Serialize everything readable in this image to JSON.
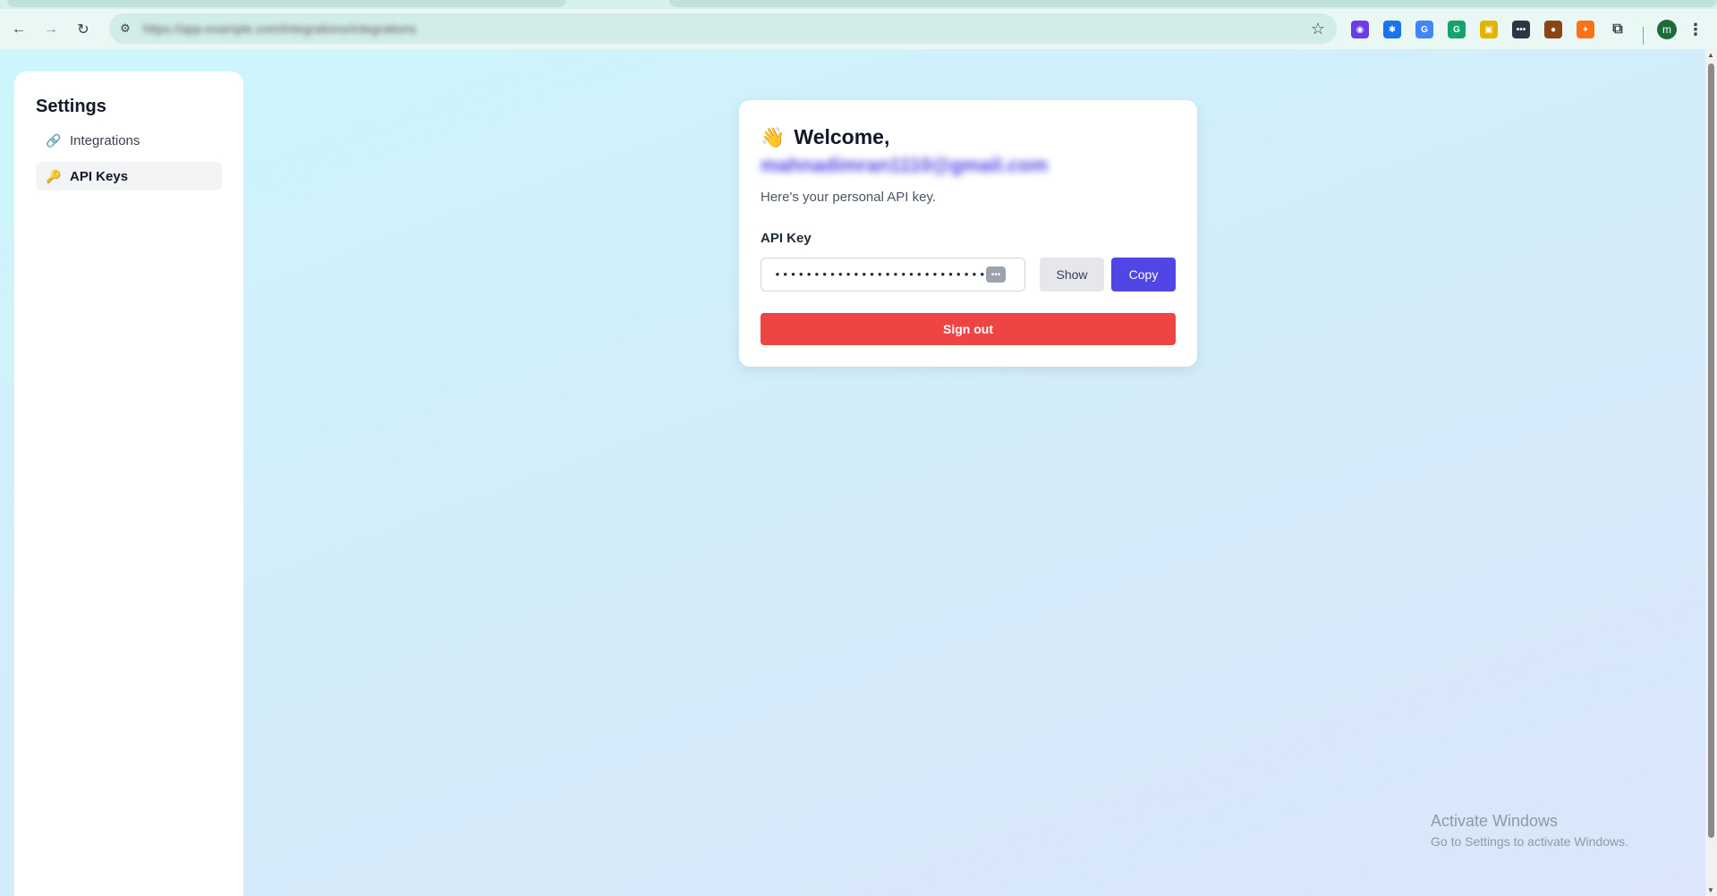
{
  "browser": {
    "url": "https://app.example.com/integrations/integrations",
    "profile_initial": "m",
    "extensions": [
      {
        "name": "color-picker-icon",
        "color": "#6a3de8",
        "glyph": "◉"
      },
      {
        "name": "extension-gear-icon",
        "color": "#1a73e8",
        "glyph": "✱"
      },
      {
        "name": "translate-icon",
        "color": "#4285f4",
        "glyph": "G"
      },
      {
        "name": "grammarly-icon",
        "color": "#15a26b",
        "glyph": "G"
      },
      {
        "name": "ad-extension-icon",
        "color": "#e2b400",
        "glyph": "▣"
      },
      {
        "name": "password-manager-icon",
        "color": "#2f3542",
        "glyph": "•••"
      },
      {
        "name": "cookie-icon",
        "color": "#8b4513",
        "glyph": "●"
      },
      {
        "name": "fire-extension-icon",
        "color": "#f97316",
        "glyph": "✦"
      },
      {
        "name": "extensions-puzzle-icon",
        "color": "#3c4043",
        "glyph": "⧉"
      }
    ]
  },
  "sidebar": {
    "title": "Settings",
    "items": [
      {
        "label": "Integrations",
        "icon": "link-icon",
        "active": false
      },
      {
        "label": "API Keys",
        "icon": "key-icon",
        "active": true
      }
    ]
  },
  "card": {
    "welcome": "Welcome,",
    "email": "mahnadimran1110@gmail.com",
    "subtitle": "Here's your personal API key.",
    "api_key_label": "API Key",
    "api_key_value": "••••••••••••••••••••••••••••",
    "show_label": "Show",
    "copy_label": "Copy",
    "signout_label": "Sign out",
    "colors": {
      "primary": "#4f46e5",
      "danger": "#ef4444"
    }
  },
  "watermark": {
    "line1": "Activate Windows",
    "line2": "Go to Settings to activate Windows."
  }
}
